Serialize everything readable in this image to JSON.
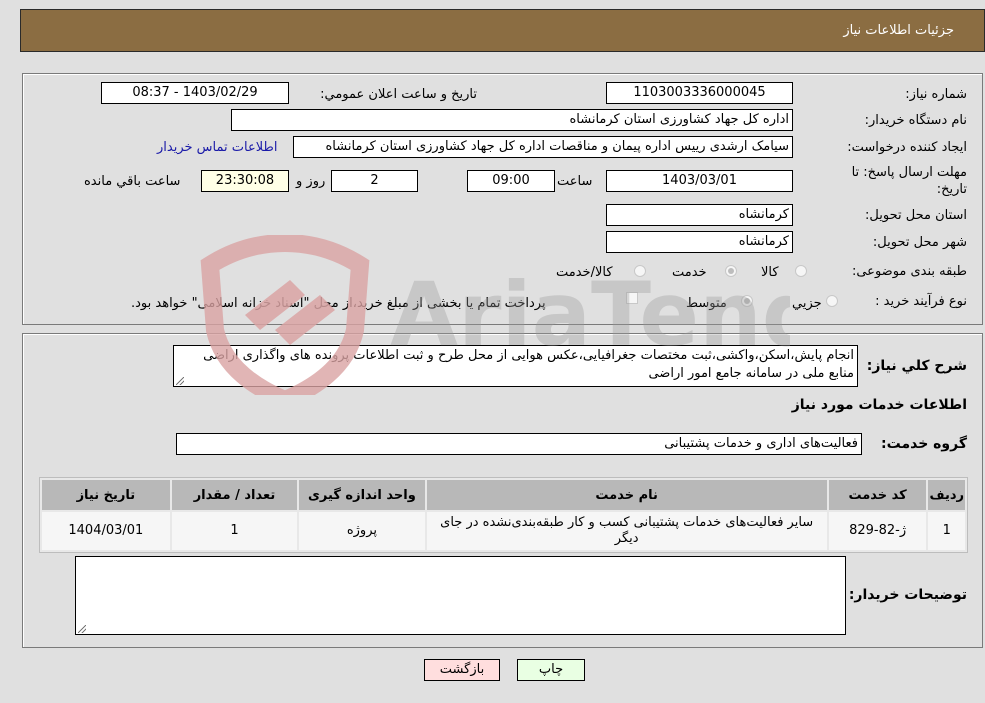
{
  "header": {
    "title": "جزئیات اطلاعات نیاز"
  },
  "details": {
    "need_number_label": "شماره نیاز:",
    "need_number": "1103003336000045",
    "announce_label": "تاریخ و ساعت اعلان عمومي:",
    "announce_value": "1403/02/29 - 08:37",
    "buyer_org_label": "نام دستگاه خریدار:",
    "buyer_org": "اداره کل جهاد کشاورزی استان کرمانشاه",
    "creator_label": "ایجاد کننده درخواست:",
    "creator": "سیامک ارشدی رییس اداره پیمان و مناقصات اداره کل جهاد کشاورزی استان کرمانشاه",
    "contact_link": "اطلاعات تماس خریدار",
    "deadline_label_line1": "مهلت ارسال پاسخ: تا",
    "deadline_label_line2": "تاریخ:",
    "deadline_date": "1403/03/01",
    "time_label": "ساعت",
    "deadline_time": "09:00",
    "days_value": "2",
    "days_label": "روز و",
    "remaining_time": "23:30:08",
    "remaining_label": "ساعت باقي مانده",
    "province_label": "استان محل تحویل:",
    "province": "کرمانشاه",
    "city_label": "شهر محل تحویل:",
    "city": "کرمانشاه",
    "category_label": "طبقه بندی موضوعی:",
    "category_options": [
      {
        "label": "کالا",
        "selected": false
      },
      {
        "label": "خدمت",
        "selected": true
      },
      {
        "label": "کالا/خدمت",
        "selected": false
      }
    ],
    "process_label": "نوع فرآیند خرید :",
    "process_options": [
      {
        "label": "جزيي",
        "selected": false
      },
      {
        "label": "متوسط",
        "selected": true
      }
    ],
    "treasury_note": "پرداخت تمام یا بخشی از مبلغ خرید،از محل \"اسناد خزانه اسلامی\" خواهد بود.",
    "treasury_checked": false
  },
  "description": {
    "label": "شرح کلي نیاز:",
    "text": "انجام پایش،اسکن،واکشی،ثبت مختصات جغرافیایی،عکس هوایی از محل طرح و ثبت اطلاعات پرونده های واگذاری اراضی منابع ملی در سامانه جامع امور اراضی"
  },
  "services": {
    "section_title": "اطلاعات خدمات مورد نیاز",
    "group_label": "گروه خدمت:",
    "group_value": "فعالیت‌های اداری و خدمات پشتیبانی",
    "columns": [
      "ردیف",
      "کد خدمت",
      "نام خدمت",
      "واحد اندازه گیری",
      "تعداد / مقدار",
      "تاریخ نیاز"
    ],
    "rows": [
      [
        "1",
        "ژ-82-829",
        "سایر فعالیت‌های خدمات پشتیبانی کسب و کار طبقه‌بندی‌نشده در جای دیگر",
        "پروژه",
        "1",
        "1404/03/01"
      ]
    ]
  },
  "buyer_notes": {
    "label": "توضیحات خریدار:",
    "text": ""
  },
  "buttons": {
    "print": "چاپ",
    "back": "بازگشت"
  },
  "watermark": {
    "text": "AriaTender.neT"
  }
}
